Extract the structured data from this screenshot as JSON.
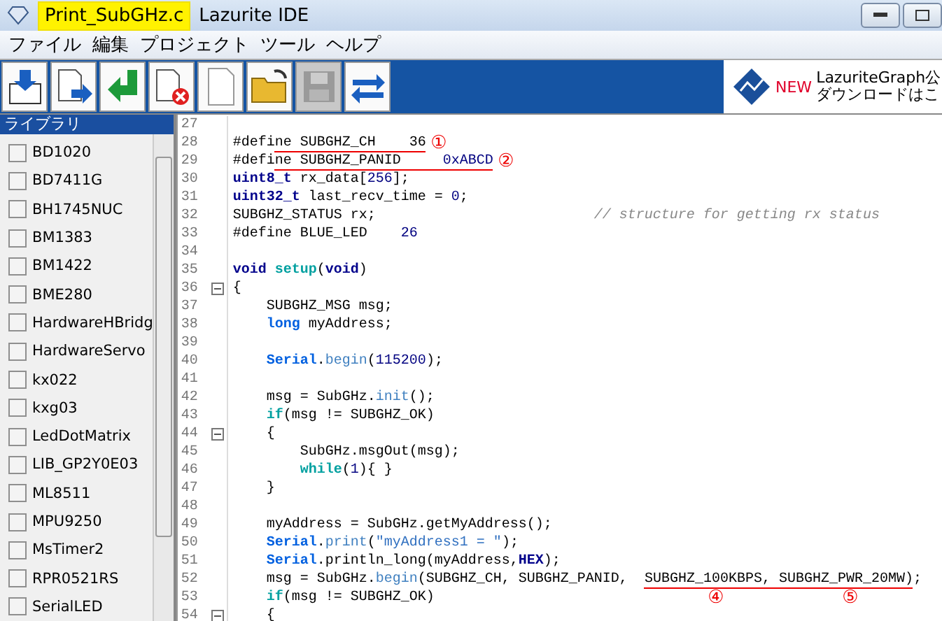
{
  "window": {
    "file_name": "Print_SubGHz.c",
    "app_name": "Lazurite IDE"
  },
  "menu": [
    "ファイル",
    "編集",
    "プロジェクト",
    "ツール",
    "ヘルプ"
  ],
  "toolbar": [
    {
      "kind": "build",
      "disabled": false
    },
    {
      "kind": "upload",
      "disabled": false
    },
    {
      "kind": "return",
      "disabled": false
    },
    {
      "kind": "stop",
      "disabled": false
    },
    {
      "kind": "new",
      "disabled": false
    },
    {
      "kind": "open",
      "disabled": false
    },
    {
      "kind": "save",
      "disabled": true
    },
    {
      "kind": "swap",
      "disabled": false
    }
  ],
  "banner": {
    "badge": "NEW",
    "line_1": "LazuriteGraph公",
    "line_2": "ダウンロードはこ"
  },
  "library": {
    "title": "ライブラリ",
    "items": [
      {
        "label": "BD1020",
        "checked": false
      },
      {
        "label": "BD7411G",
        "checked": false
      },
      {
        "label": "BH1745NUC",
        "checked": false
      },
      {
        "label": "BM1383",
        "checked": false
      },
      {
        "label": "BM1422",
        "checked": false
      },
      {
        "label": "BME280",
        "checked": false
      },
      {
        "label": "HardwareHBridg",
        "checked": false
      },
      {
        "label": "HardwareServo",
        "checked": false
      },
      {
        "label": "kx022",
        "checked": false
      },
      {
        "label": "kxg03",
        "checked": false
      },
      {
        "label": "LedDotMatrix",
        "checked": false
      },
      {
        "label": "LIB_GP2Y0E03",
        "checked": false
      },
      {
        "label": "ML8511",
        "checked": false
      },
      {
        "label": "MPU9250",
        "checked": false
      },
      {
        "label": "MsTimer2",
        "checked": false
      },
      {
        "label": "RPR0521RS",
        "checked": false
      },
      {
        "label": "SerialLED",
        "checked": false
      }
    ]
  },
  "editor": {
    "lines": [
      {
        "number": "27",
        "fold": false
      },
      {
        "number": "28",
        "fold": false,
        "tokens": [
          {
            "kind": "plain",
            "text": "#defi"
          },
          {
            "kind": "plain",
            "text": "ne SUBGHZ_CH    36",
            "underlined": true
          },
          {
            "kind": "note",
            "text": "①"
          }
        ]
      },
      {
        "number": "29",
        "fold": false,
        "tokens": [
          {
            "kind": "plain",
            "text": "#defi"
          },
          {
            "kind": "plain",
            "text": "ne SUBGHZ_PANID     ",
            "underlined": true
          },
          {
            "kind": "number",
            "text": "0xABCD",
            "underlined": true
          },
          {
            "kind": "note",
            "text": "②"
          }
        ]
      },
      {
        "number": "30",
        "fold": false,
        "tokens": [
          {
            "kind": "type",
            "text": "uint8_t"
          },
          {
            "kind": "plain",
            "text": " rx_data["
          },
          {
            "kind": "number",
            "text": "256"
          },
          {
            "kind": "plain",
            "text": "];"
          }
        ]
      },
      {
        "number": "31",
        "fold": false,
        "tokens": [
          {
            "kind": "type",
            "text": "uint32_t"
          },
          {
            "kind": "plain",
            "text": " last_recv_time = "
          },
          {
            "kind": "number",
            "text": "0"
          },
          {
            "kind": "plain",
            "text": ";"
          }
        ]
      },
      {
        "number": "32",
        "fold": false,
        "tokens": [
          {
            "kind": "plain",
            "text": "SUBGHZ_STATUS rx;                          "
          },
          {
            "kind": "comment",
            "text": "// structure for getting rx status"
          }
        ]
      },
      {
        "number": "33",
        "fold": false,
        "tokens": [
          {
            "kind": "plain",
            "text": "#define BLUE_LED    "
          },
          {
            "kind": "number",
            "text": "26"
          }
        ]
      },
      {
        "number": "34",
        "fold": false
      },
      {
        "number": "35",
        "fold": false,
        "tokens": [
          {
            "kind": "type",
            "text": "void "
          },
          {
            "kind": "keyword",
            "text": "setup"
          },
          {
            "kind": "plain",
            "text": "("
          },
          {
            "kind": "type",
            "text": "void"
          },
          {
            "kind": "plain",
            "text": ")"
          }
        ]
      },
      {
        "number": "36",
        "fold": true,
        "tokens": [
          {
            "kind": "plain",
            "text": "{"
          }
        ]
      },
      {
        "number": "37",
        "fold": false,
        "tokens": [
          {
            "kind": "plain",
            "text": "    SUBGHZ_MSG msg;"
          }
        ]
      },
      {
        "number": "38",
        "fold": false,
        "tokens": [
          {
            "kind": "builtin",
            "text": "    long"
          },
          {
            "kind": "plain",
            "text": " myAddress;"
          }
        ]
      },
      {
        "number": "39",
        "fold": false
      },
      {
        "number": "40",
        "fold": false,
        "tokens": [
          {
            "kind": "builtin",
            "text": "    Serial"
          },
          {
            "kind": "plain",
            "text": "."
          },
          {
            "kind": "func",
            "text": "begin"
          },
          {
            "kind": "plain",
            "text": "("
          },
          {
            "kind": "number",
            "text": "115200"
          },
          {
            "kind": "plain",
            "text": ");"
          }
        ]
      },
      {
        "number": "41",
        "fold": false
      },
      {
        "number": "42",
        "fold": false,
        "tokens": [
          {
            "kind": "plain",
            "text": "    msg = SubGHz."
          },
          {
            "kind": "func",
            "text": "init"
          },
          {
            "kind": "plain",
            "text": "();"
          }
        ]
      },
      {
        "number": "43",
        "fold": false,
        "tokens": [
          {
            "kind": "keyword",
            "text": "    if"
          },
          {
            "kind": "plain",
            "text": "(msg != SUBGHZ_OK)"
          }
        ]
      },
      {
        "number": "44",
        "fold": true,
        "tokens": [
          {
            "kind": "plain",
            "text": "    {"
          }
        ]
      },
      {
        "number": "45",
        "fold": false,
        "tokens": [
          {
            "kind": "plain",
            "text": "        SubGHz.msgOut(msg);"
          }
        ]
      },
      {
        "number": "46",
        "fold": false,
        "tokens": [
          {
            "kind": "keyword",
            "text": "        while"
          },
          {
            "kind": "plain",
            "text": "("
          },
          {
            "kind": "number",
            "text": "1"
          },
          {
            "kind": "plain",
            "text": "){ }"
          }
        ]
      },
      {
        "number": "47",
        "fold": false,
        "tokens": [
          {
            "kind": "plain",
            "text": "    }"
          }
        ]
      },
      {
        "number": "48",
        "fold": false
      },
      {
        "number": "49",
        "fold": false,
        "tokens": [
          {
            "kind": "plain",
            "text": "    myAddress = SubGHz.getMyAddress();"
          }
        ]
      },
      {
        "number": "50",
        "fold": false,
        "tokens": [
          {
            "kind": "builtin",
            "text": "    Serial"
          },
          {
            "kind": "plain",
            "text": "."
          },
          {
            "kind": "func",
            "text": "print"
          },
          {
            "kind": "plain",
            "text": "("
          },
          {
            "kind": "string",
            "text": "\"myAddress1 = \""
          },
          {
            "kind": "plain",
            "text": ");"
          }
        ]
      },
      {
        "number": "51",
        "fold": false,
        "tokens": [
          {
            "kind": "builtin",
            "text": "    Serial"
          },
          {
            "kind": "plain",
            "text": ".println_long(myAddress,"
          },
          {
            "kind": "type",
            "text": "HEX"
          },
          {
            "kind": "plain",
            "text": ");"
          }
        ]
      },
      {
        "number": "52",
        "fold": false,
        "tokens": [
          {
            "kind": "plain",
            "text": "    msg = SubGHz."
          },
          {
            "kind": "func",
            "text": "begin"
          },
          {
            "kind": "plain",
            "text": "(SUBGHZ_CH, SUBGHZ_PANID,  "
          },
          {
            "kind": "plain",
            "text": "SUBGHZ_100KBPS,",
            "underlined": true
          },
          {
            "kind": "plain",
            "text": " SUBGHZ_PWR_20MW)",
            "underlined": true
          },
          {
            "kind": "plain",
            "text": ";"
          }
        ]
      },
      {
        "number": "53",
        "fold": false,
        "tokens": [
          {
            "kind": "keyword",
            "text": "    if"
          },
          {
            "kind": "plain",
            "text": "(msg != SUBGHZ_OK)                                "
          },
          {
            "kind": "note",
            "text": "④"
          },
          {
            "kind": "note",
            "text": "⑤"
          }
        ]
      },
      {
        "number": "54",
        "fold": true,
        "tokens": [
          {
            "kind": "plain",
            "text": "    {"
          }
        ]
      }
    ]
  }
}
